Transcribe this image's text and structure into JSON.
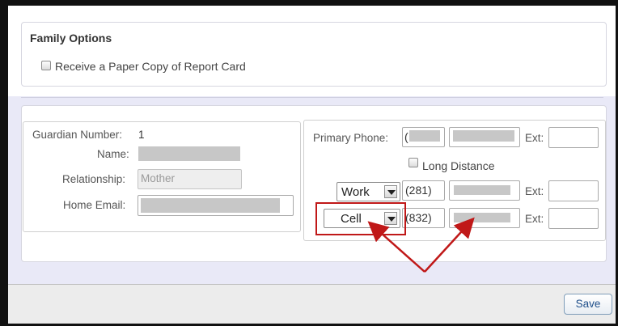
{
  "family_options": {
    "title": "Family Options",
    "paper_copy_label": "Receive a Paper Copy of Report Card",
    "paper_copy_checked": false
  },
  "guardian": {
    "number_label": "Guardian Number:",
    "number_value": "1",
    "name_label": "Name:",
    "relationship_label": "Relationship:",
    "relationship_value": "Mother",
    "home_email_label": "Home Email:"
  },
  "phones": {
    "primary_label": "Primary Phone:",
    "primary_area_prefix": "(",
    "ext_label": "Ext:",
    "long_distance_label": "Long Distance",
    "long_distance_checked": false,
    "work": {
      "type": "Work",
      "area_code": "(281)"
    },
    "cell": {
      "type": "Cell",
      "area_code": "(832)"
    }
  },
  "footer": {
    "save_label": "Save"
  },
  "colors": {
    "background_lavender": "#e9e9f7",
    "annotation_red": "#c01818",
    "save_text": "#1f4f8a"
  }
}
